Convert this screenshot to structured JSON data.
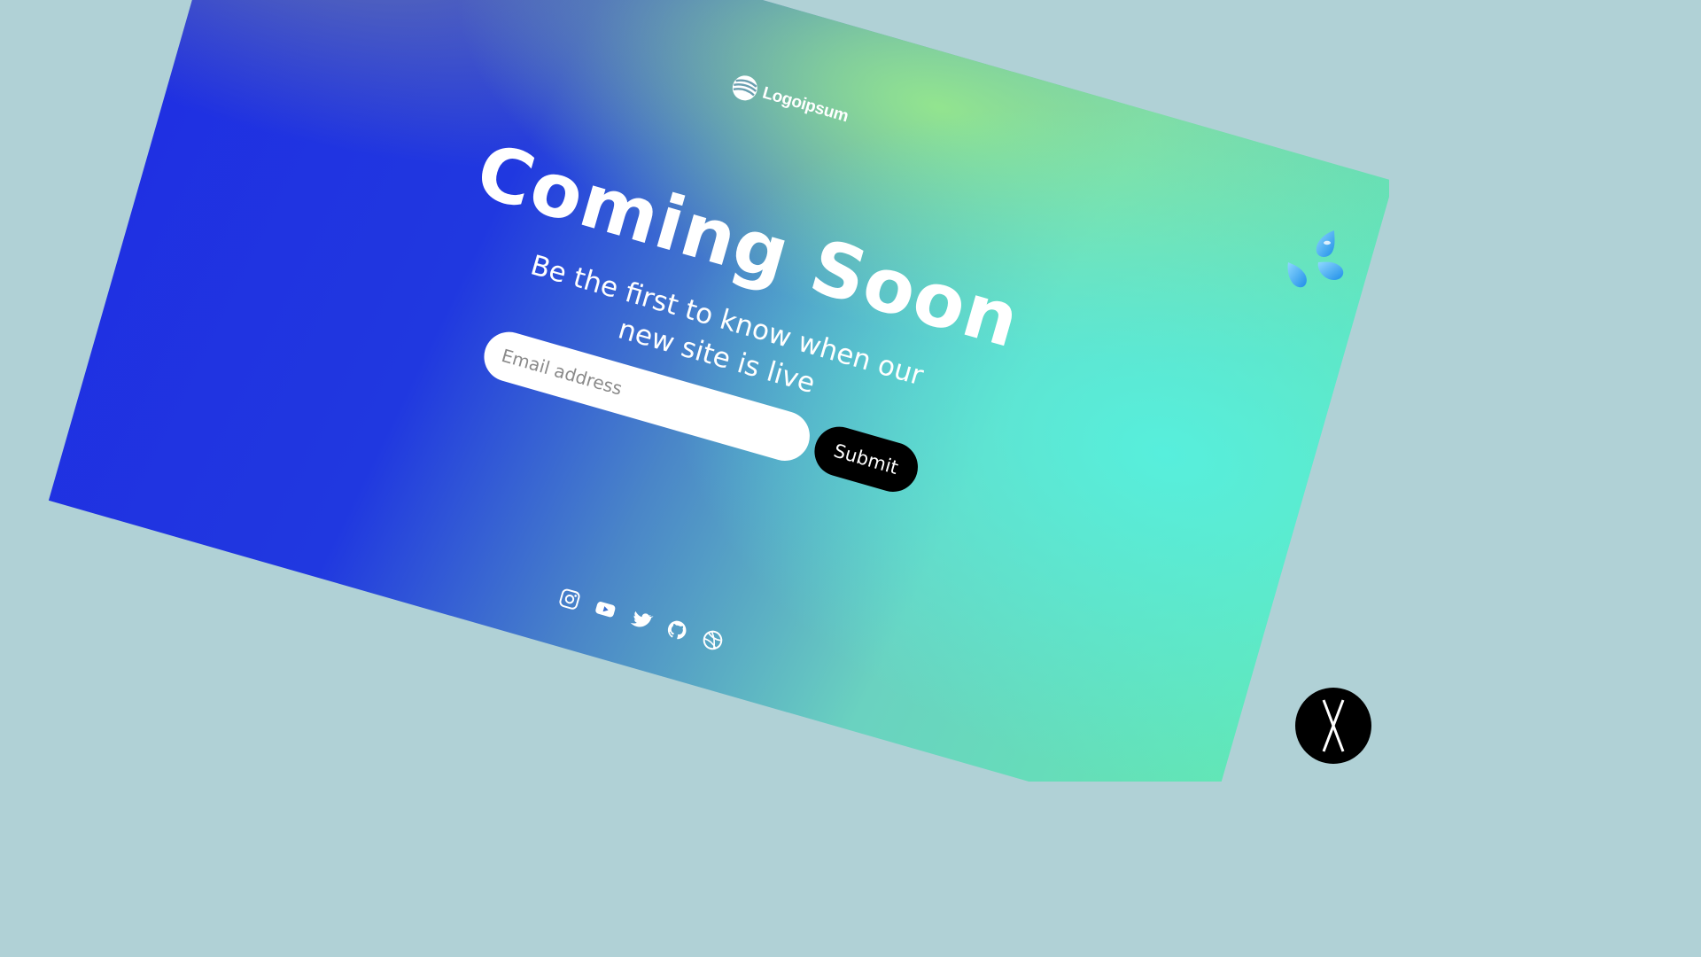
{
  "brand": {
    "name": "Logoipsum"
  },
  "hero": {
    "title": "Coming Soon",
    "subtitle_line1": "Be the first to know when our",
    "subtitle_line2": "new site is live"
  },
  "signup": {
    "email_placeholder": "Email address",
    "submit_label": "Submit"
  },
  "socials": [
    {
      "icon": "instagram-icon"
    },
    {
      "icon": "youtube-icon"
    },
    {
      "icon": "twitter-icon"
    },
    {
      "icon": "github-icon"
    },
    {
      "icon": "dribbble-icon"
    }
  ],
  "colors": {
    "background": "#b0d1d6",
    "gradient_blue": "#1f2fe2",
    "gradient_green": "#96e88c",
    "gradient_cyan": "#56f0de",
    "button": "#000000",
    "text": "#ffffff"
  },
  "decorations": {
    "top_right": "sweat-droplets-emoji",
    "bottom_right": "x-logo-badge"
  }
}
